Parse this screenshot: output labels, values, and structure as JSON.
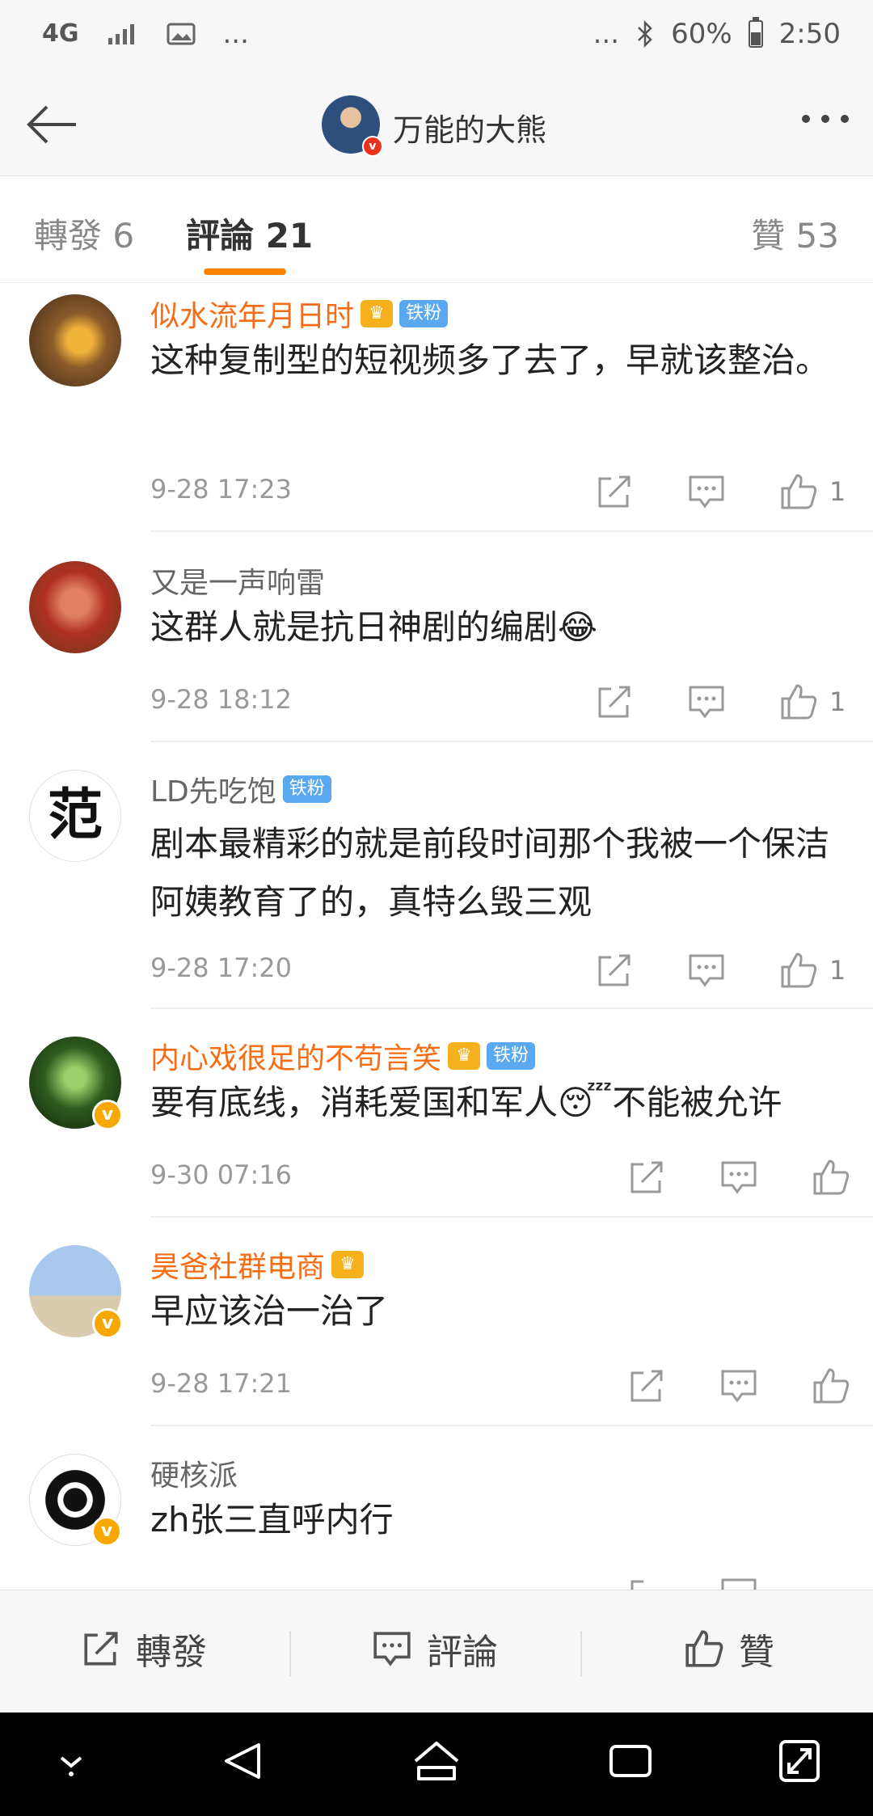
{
  "status_bar": {
    "network": "4G",
    "overflow": "...",
    "overflow_right": "...",
    "battery_percent": "60%",
    "time": "2:50"
  },
  "header": {
    "title": "万能的大熊",
    "avatar_badge": "v"
  },
  "tabs": {
    "repost": "轉發 6",
    "comments": "評論 21",
    "likes": "贊 53"
  },
  "comments": [
    {
      "name": "似水流年月日时",
      "name_color": "#f86c13",
      "crown": true,
      "fan_badge": "铁粉",
      "verified": false,
      "text": "这种复制型的短视频多了去了，早就该整治。",
      "time": "9-28 17:23",
      "likes": "1"
    },
    {
      "name": "又是一声响雷",
      "name_color": "#666666",
      "crown": false,
      "fan_badge": "",
      "verified": false,
      "text": "这群人就是抗日神剧的编剧😂",
      "time": "9-28 18:12",
      "likes": "1"
    },
    {
      "name": "LD先吃饱",
      "name_color": "#666666",
      "crown": false,
      "fan_badge": "铁粉",
      "verified": false,
      "text": "剧本最精彩的就是前段时间那个我被一个保洁阿姨教育了的，真特么毁三观",
      "time": "9-28 17:20",
      "likes": "1"
    },
    {
      "name": "内心戏很足的不苟言笑",
      "name_color": "#f86c13",
      "crown": true,
      "fan_badge": "铁粉",
      "verified": true,
      "text": "要有底线，消耗爱国和军人😴不能被允许",
      "time": "9-30 07:16",
      "likes": ""
    },
    {
      "name": "昊爸社群电商",
      "name_color": "#f86c13",
      "crown": true,
      "fan_badge": "",
      "verified": true,
      "text": "早应该治一治了",
      "time": "9-28 17:21",
      "likes": ""
    },
    {
      "name": "硬核派",
      "name_color": "#666666",
      "crown": false,
      "fan_badge": "",
      "verified": true,
      "text": "zh张三直呼内行",
      "time": "",
      "likes": ""
    }
  ],
  "avatar_glyphs": {
    "c3": "范"
  },
  "bottom_bar": {
    "repost": "轉發",
    "comment": "評論",
    "like": "贊"
  },
  "colors": {
    "accent": "#ff8200",
    "orange_name": "#f86c13",
    "fan_badge": "#5aa9f0",
    "verified_badge": "#f7a800"
  }
}
